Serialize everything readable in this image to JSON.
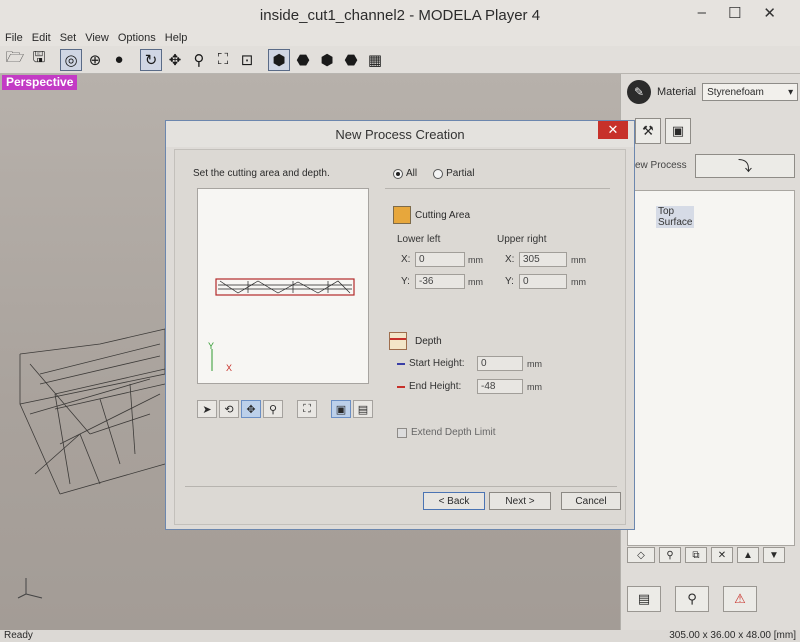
{
  "window": {
    "title": "inside_cut1_channel2 - MODELA Player 4",
    "min": "–",
    "max": "☐",
    "close": "✕"
  },
  "menu": [
    "File",
    "Edit",
    "Set",
    "View",
    "Options",
    "Help"
  ],
  "toolbar_icons": [
    "folder-open-icon",
    "save-icon",
    "globe-wire-icon",
    "globe-solid-icon",
    "sphere-icon",
    "rotate-icon",
    "pan-icon",
    "zoom-icon",
    "fit-icon",
    "zoom-box-icon",
    "cube-dark-icon",
    "cube-front-icon",
    "cube-right-icon",
    "cube-top-icon",
    "grid-icon"
  ],
  "viewport": {
    "label": "Perspective"
  },
  "right_panel": {
    "material_label": "Material",
    "material_value": "Styrenefoam",
    "new_process_label": "ew Process",
    "tree_item": "Top Surface"
  },
  "status": {
    "left": "Ready",
    "right": "305.00 x 36.00 x 48.00 [mm]"
  },
  "dialog": {
    "title": "New Process Creation",
    "close": "✕",
    "instruction": "Set the cutting area and depth.",
    "radio_all": "All",
    "radio_partial": "Partial",
    "cutting_area": {
      "title": "Cutting Area",
      "lower_left": "Lower left",
      "upper_right": "Upper right",
      "x_label": "X:",
      "y_label": "Y:",
      "ll_x": "0",
      "ll_y": "-36",
      "ur_x": "305",
      "ur_y": "0",
      "unit": "mm"
    },
    "depth": {
      "title": "Depth",
      "start_label": "Start Height:",
      "start_value": "0",
      "end_label": "End Height:",
      "end_value": "-48",
      "unit": "mm"
    },
    "extend_label": "Extend Depth Limit",
    "buttons": {
      "back": "< Back",
      "next": "Next >",
      "cancel": "Cancel"
    },
    "preview_axes": {
      "y": "Y",
      "x": "X"
    }
  },
  "colors": {
    "perspective_badge": "#c33bc5",
    "close_red": "#c7312a",
    "cutting_icon": "#e7a73c",
    "focus_blue": "#4b74b3"
  }
}
